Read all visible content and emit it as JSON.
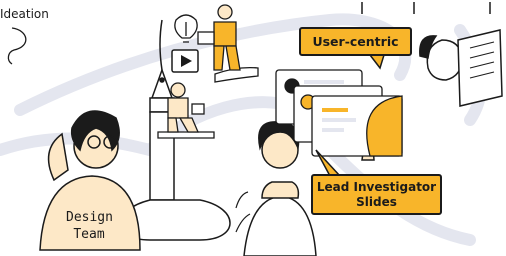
{
  "labels": {
    "ideation": "Ideation",
    "user_centric": "User-centric",
    "lead_line1": "Lead Investigator",
    "lead_line2": "Slides",
    "design_line1": "Design",
    "design_line2": "Team"
  },
  "colors": {
    "accent": "#f8b52a",
    "skin": "#fde8c7",
    "path": "#e4e6ef",
    "ink": "#1b1b1b"
  },
  "icons": [
    "play-icon",
    "lightbulb-icon",
    "pen-nib-icon",
    "laptop-icon",
    "book-icon",
    "scroll-icon"
  ]
}
